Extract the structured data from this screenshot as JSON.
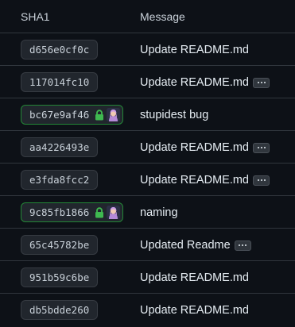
{
  "headers": {
    "sha": "SHA1",
    "message": "Message"
  },
  "colors": {
    "background": "#0d1117",
    "verified_border": "#238636",
    "lock": "#3fb950",
    "row_divider": "#30363d"
  },
  "commits": [
    {
      "sha": "d656e0cf0c",
      "message": "Update README.md",
      "verified": false,
      "expandable": false
    },
    {
      "sha": "117014fc10",
      "message": "Update README.md",
      "verified": false,
      "expandable": true
    },
    {
      "sha": "bc67e9af46",
      "message": "stupidest bug",
      "verified": true,
      "expandable": false
    },
    {
      "sha": "aa4226493e",
      "message": "Update README.md",
      "verified": false,
      "expandable": true
    },
    {
      "sha": "e3fda8fcc2",
      "message": "Update README.md",
      "verified": false,
      "expandable": true
    },
    {
      "sha": "9c85fb1866",
      "message": "naming",
      "verified": true,
      "expandable": false
    },
    {
      "sha": "65c45782be",
      "message": "Updated Readme",
      "verified": false,
      "expandable": true
    },
    {
      "sha": "951b59c6be",
      "message": "Update README.md",
      "verified": false,
      "expandable": false
    },
    {
      "sha": "db5bdde260",
      "message": "Update README.md",
      "verified": false,
      "expandable": false
    }
  ],
  "icons": {
    "verified": "lock-icon",
    "author": "avatar",
    "expand": "ellipsis-icon"
  }
}
